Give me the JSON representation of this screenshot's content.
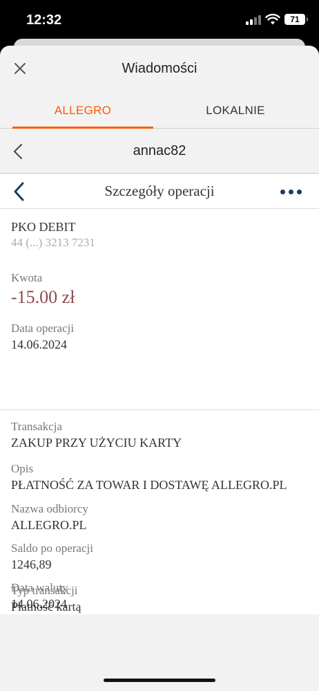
{
  "status": {
    "time": "12:32",
    "battery": "71"
  },
  "sheet": {
    "title": "Wiadomości"
  },
  "tabs": [
    {
      "label": "ALLEGRO",
      "active": true
    },
    {
      "label": "LOKALNIE",
      "active": false
    }
  ],
  "conversation": {
    "name": "annac82"
  },
  "operation": {
    "header_title": "Szczegóły operacji",
    "card_name": "PKO DEBIT",
    "card_number": "44 (...) 3213 7231",
    "amount_label": "Kwota",
    "amount": "-15.00 zł",
    "date_label": "Data operacji",
    "date": "14.06.2024",
    "transaction_label": "Transakcja",
    "transaction": "ZAKUP PRZY UŻYCIU KARTY",
    "description_label": "Opis",
    "description": "PŁATNOŚĆ ZA TOWAR I DOSTAWĘ ALLEGRO.PL",
    "recipient_label": "Nazwa odbiorcy",
    "recipient": "ALLEGRO.PL",
    "balance_label": "Saldo po operacji",
    "balance": "1246,89",
    "type_label": "Typ transakcji",
    "type": "Płatność kartą",
    "value_date_label": "Data waluty",
    "value_date": "14.06.2024"
  },
  "colors": {
    "accent": "#ff5a00",
    "bank_nav": "#1a3b64",
    "amount": "#8b4a4f"
  },
  "icons": [
    "close-icon",
    "back-chevron-icon",
    "more-dots-icon",
    "signal-icon",
    "wifi-icon",
    "battery-icon"
  ]
}
